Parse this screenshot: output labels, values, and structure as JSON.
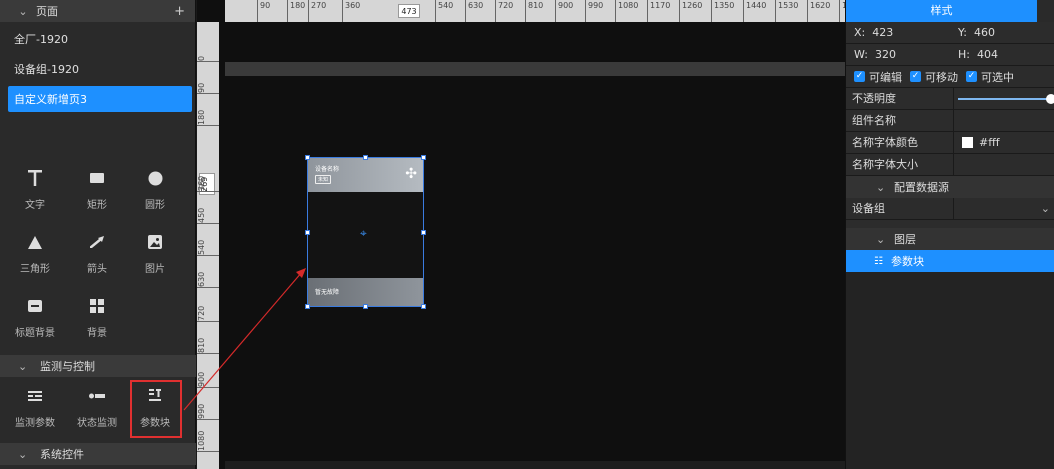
{
  "left": {
    "pages_header": "页面",
    "pages": [
      {
        "label": "全厂-1920"
      },
      {
        "label": "设备组-1920"
      },
      {
        "label": "自定义新增页3"
      }
    ],
    "basic_components": [
      {
        "label": "文字",
        "icon": "text-icon"
      },
      {
        "label": "矩形",
        "icon": "rectangle-icon"
      },
      {
        "label": "圆形",
        "icon": "circle-icon"
      },
      {
        "label": "三角形",
        "icon": "triangle-icon"
      },
      {
        "label": "箭头",
        "icon": "arrow-icon"
      },
      {
        "label": "图片",
        "icon": "image-icon"
      },
      {
        "label": "标题背景",
        "icon": "title-bg-icon"
      },
      {
        "label": "背景",
        "icon": "background-icon"
      }
    ],
    "monitor_section": "监测与控制",
    "monitor_components": [
      {
        "label": "监测参数",
        "icon": "monitor-param-icon"
      },
      {
        "label": "状态监测",
        "icon": "status-monitor-icon"
      },
      {
        "label": "参数块",
        "icon": "param-block-icon"
      }
    ],
    "system_section": "系统控件"
  },
  "canvas": {
    "ruler_top_ticks": [
      "90",
      "180",
      "270",
      "360",
      "540",
      "630",
      "720",
      "810",
      "900",
      "990",
      "1080",
      "1170",
      "1260",
      "1350",
      "1440",
      "1530",
      "1620",
      "1"
    ],
    "ruler_top_marker": "473",
    "ruler_left_ticks": [
      "0",
      "90",
      "180",
      "360",
      "450",
      "540",
      "630",
      "720",
      "810",
      "900",
      "990",
      "1080"
    ],
    "ruler_left_marker": "269",
    "widget": {
      "title": "设备名称",
      "tag": "未知",
      "footer": "暂无故障"
    }
  },
  "right": {
    "tab": "样式",
    "x_label": "X:",
    "x_value": "423",
    "y_label": "Y:",
    "y_value": "460",
    "w_label": "W:",
    "w_value": "320",
    "h_label": "H:",
    "h_value": "404",
    "checks": [
      "可编辑",
      "可移动",
      "可选中"
    ],
    "opacity_label": "不透明度",
    "opacity_value": 1.0,
    "name_label": "组件名称",
    "font_color_label": "名称字体颜色",
    "font_color_value": "#fff",
    "font_size_label": "名称字体大小",
    "datasource_section": "配置数据源",
    "device_group_label": "设备组",
    "layers_section": "图层",
    "layer_item": "参数块"
  }
}
